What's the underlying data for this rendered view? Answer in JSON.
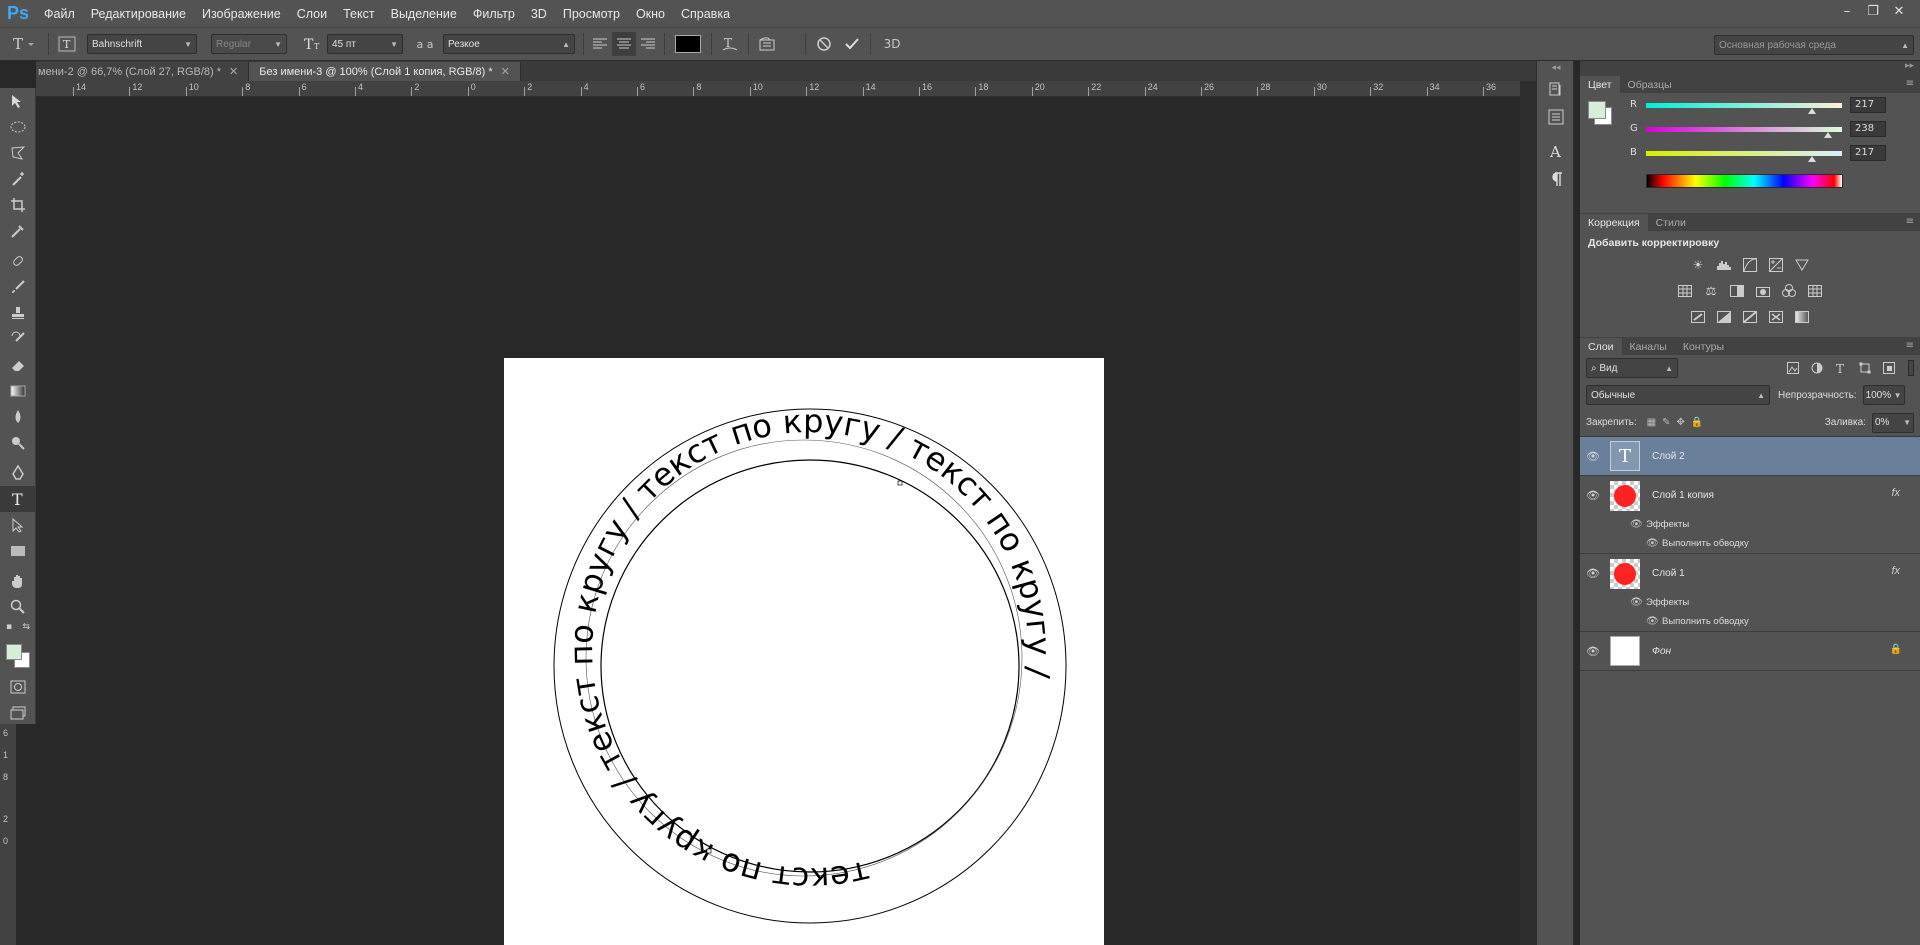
{
  "app": {
    "logo": "Ps"
  },
  "menu": [
    "Файл",
    "Редактирование",
    "Изображение",
    "Слои",
    "Текст",
    "Выделение",
    "Фильтр",
    "3D",
    "Просмотр",
    "Окно",
    "Справка"
  ],
  "window_controls": {
    "minimize": "–",
    "restore": "❐",
    "close": "✕"
  },
  "options": {
    "font_family": "Bahnschrift",
    "font_style": "Regular",
    "font_size": "45 пт",
    "aa_label": "a a",
    "antialias": "Резкое",
    "threeD": "3D",
    "workspace": "Основная рабочая среда",
    "text_color": "#000000"
  },
  "doc_tabs": [
    {
      "label": "мени-2 @ 66,7% (Слой 27, RGB/8) *",
      "close": "✕"
    },
    {
      "label": "Без имени-3 @ 100% (Слой 1 копия, RGB/8) *",
      "close": "✕"
    }
  ],
  "ruler": {
    "h_labels": [
      "14",
      "12",
      "10",
      "8",
      "6",
      "4",
      "2",
      "0",
      "2",
      "4",
      "6",
      "8",
      "10",
      "12",
      "14",
      "16",
      "18",
      "20",
      "22",
      "24",
      "26",
      "28",
      "30",
      "32",
      "34",
      "36"
    ],
    "v_labels": [
      "6",
      "1",
      "8",
      "2",
      "0"
    ]
  },
  "canvas": {
    "circle_text": "текст по кругу / текст по кругу / текст по кругу / текст по кругу / ",
    "circle_color": "#000000"
  },
  "color_panel": {
    "tabs": [
      "Цвет",
      "Образцы"
    ],
    "r": {
      "label": "R",
      "value": "217"
    },
    "g": {
      "label": "G",
      "value": "238"
    },
    "b": {
      "label": "B",
      "value": "217"
    },
    "fg_color": "#d9eed9",
    "bg_color": "#ffffff"
  },
  "adjust_panel": {
    "tabs": [
      "Коррекция",
      "Стили"
    ],
    "title": "Добавить корректировку"
  },
  "layers_panel": {
    "tabs": [
      "Слои",
      "Каналы",
      "Контуры"
    ],
    "filter": "Вид",
    "blend_mode": "Обычные",
    "opacity_label": "Непрозрачность:",
    "opacity": "100%",
    "lock_label": "Закрепить:",
    "fill_label": "Заливка:",
    "fill": "0%",
    "layers": [
      {
        "name": "Слой 2",
        "type": "text"
      },
      {
        "name": "Слой 1 копия",
        "type": "shape",
        "effects": "Эффекты",
        "effect": "Выполнить обводку"
      },
      {
        "name": "Слой 1",
        "type": "shape",
        "effects": "Эффекты",
        "effect": "Выполнить обводку"
      },
      {
        "name": "Фон",
        "type": "background"
      }
    ]
  }
}
